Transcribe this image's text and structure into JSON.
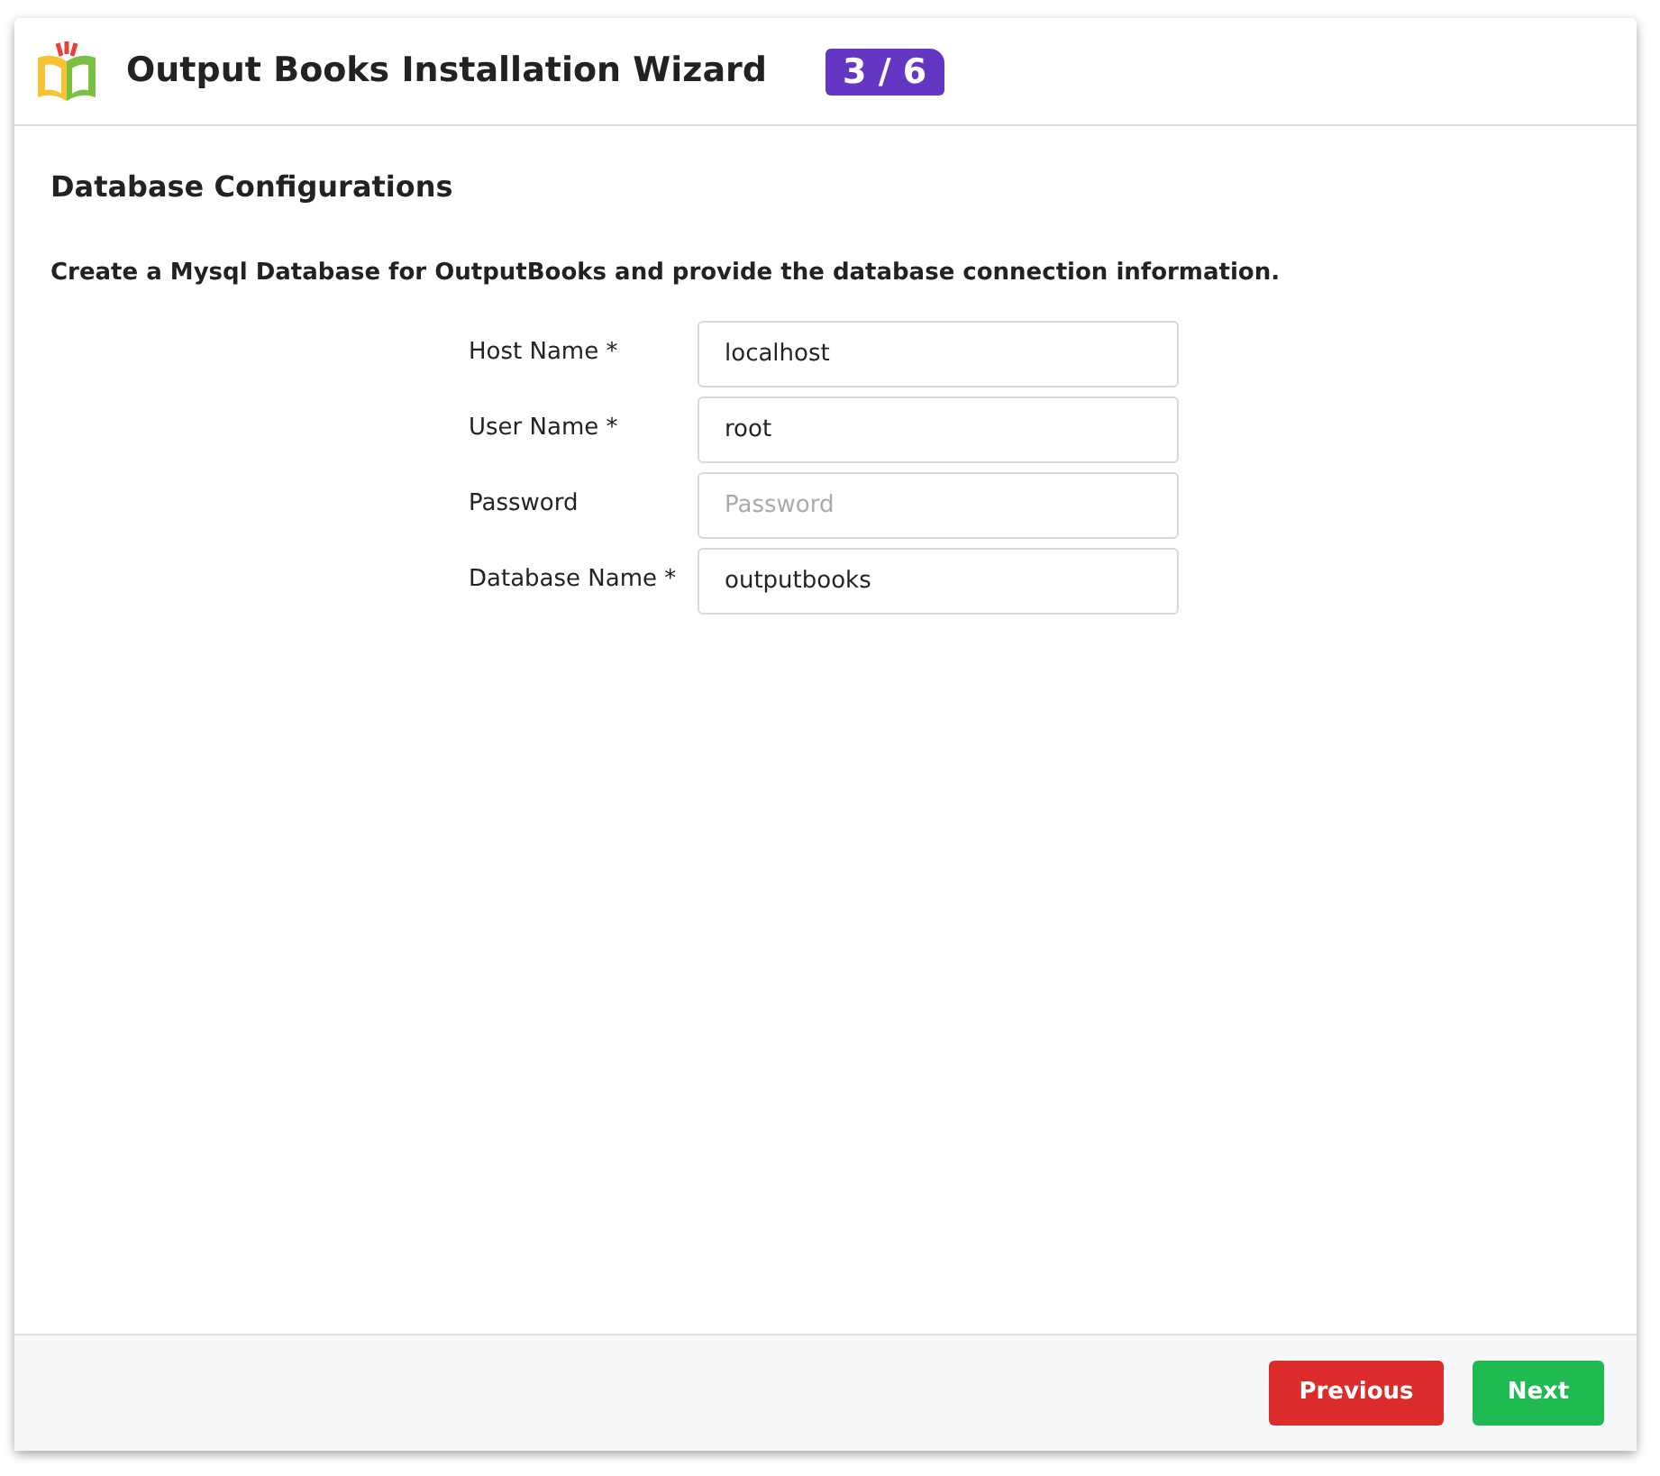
{
  "header": {
    "title": "Output Books Installation Wizard",
    "step": "3 / 6"
  },
  "section_title": "Database Configurations",
  "instructions": "Create a Mysql Database for OutputBooks and provide the database connection information.",
  "fields": [
    {
      "label": "Host Name *",
      "value": "localhost"
    },
    {
      "label": "User Name *",
      "value": "root"
    },
    {
      "label": "Password",
      "placeholder": "Password"
    },
    {
      "label": "Database Name *",
      "value": "outputbooks"
    }
  ],
  "buttons": [
    {
      "label": "Previous",
      "kind": "danger"
    },
    {
      "label": "Next",
      "kind": "success"
    }
  ]
}
